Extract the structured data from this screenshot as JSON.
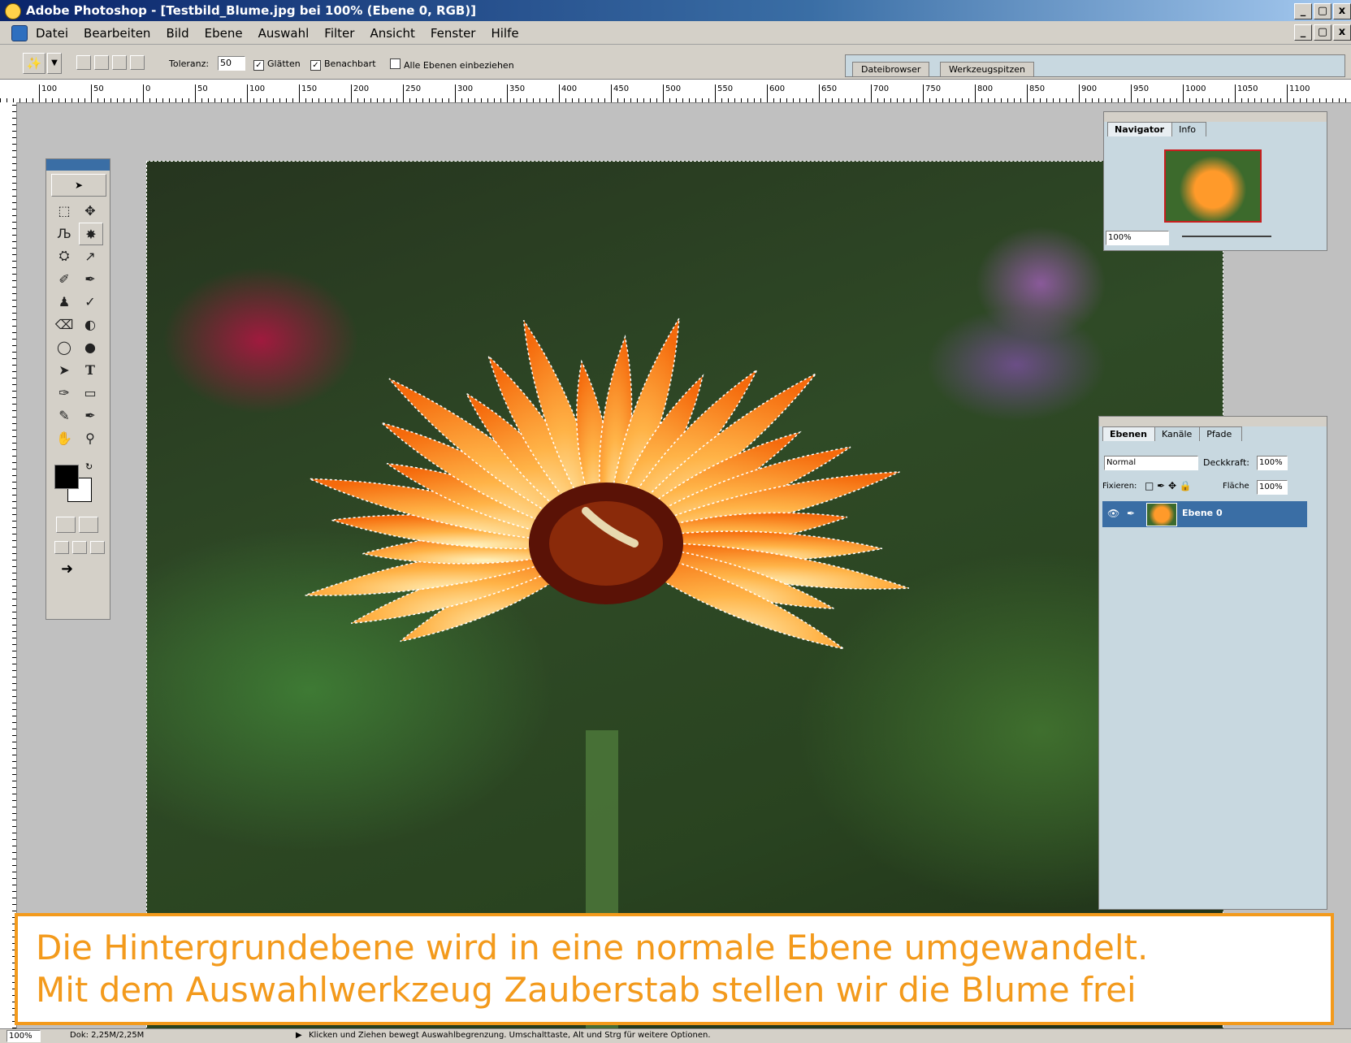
{
  "window": {
    "title": "Adobe Photoshop - [Testbild_Blume.jpg bei 100% (Ebene 0, RGB)]",
    "btn_min": "_",
    "btn_max": " ",
    "btn_close": "x"
  },
  "menu": [
    "Datei",
    "Bearbeiten",
    "Bild",
    "Ebene",
    "Auswahl",
    "Filter",
    "Ansicht",
    "Fenster",
    "Hilfe"
  ],
  "options": {
    "tolerance_label": "Toleranz:",
    "tolerance_value": "50",
    "smooth_label": "Glätten",
    "contiguous_label": "Benachbart",
    "all_layers_label": "Alle Ebenen einbeziehen",
    "tab_filebrowser": "Dateibrowser",
    "tab_brushes": "Werkzeugspitzen"
  },
  "ruler_ticks": [
    "100",
    "50",
    "0",
    "50",
    "100",
    "150",
    "200",
    "250",
    "300",
    "350",
    "400",
    "450",
    "500",
    "550",
    "600",
    "650",
    "700",
    "750",
    "800",
    "850",
    "900",
    "950",
    "1000",
    "1050",
    "1100"
  ],
  "navigator": {
    "tab_navigator": "Navigator",
    "tab_info": "Info",
    "zoom": "100%"
  },
  "layers": {
    "tab_layers": "Ebenen",
    "tab_channels": "Kanäle",
    "tab_paths": "Pfade",
    "blend_mode": "Normal",
    "opacity_label": "Deckkraft:",
    "opacity_value": "100%",
    "lock_label": "Fixieren:",
    "fill_label": "Fläche",
    "fill_value": "100%",
    "layer_name": "Ebene 0"
  },
  "caption": {
    "line1": "Die Hintergrundebene wird in eine normale Ebene umgewandelt.",
    "line2": "Mit dem Auswahlwerkzeug Zauberstab stellen wir die Blume frei"
  },
  "status": {
    "zoom": "100%",
    "doc_size": "Dok: 2,25M/2,25M",
    "hint": "Klicken und Ziehen bewegt Auswahlbegrenzung. Umschalttaste, Alt und Strg für weitere Optionen."
  },
  "colors": {
    "caption_orange": "#f39a1c",
    "title_blue": "#0a246a",
    "layer_selected": "#3a6ea5"
  }
}
